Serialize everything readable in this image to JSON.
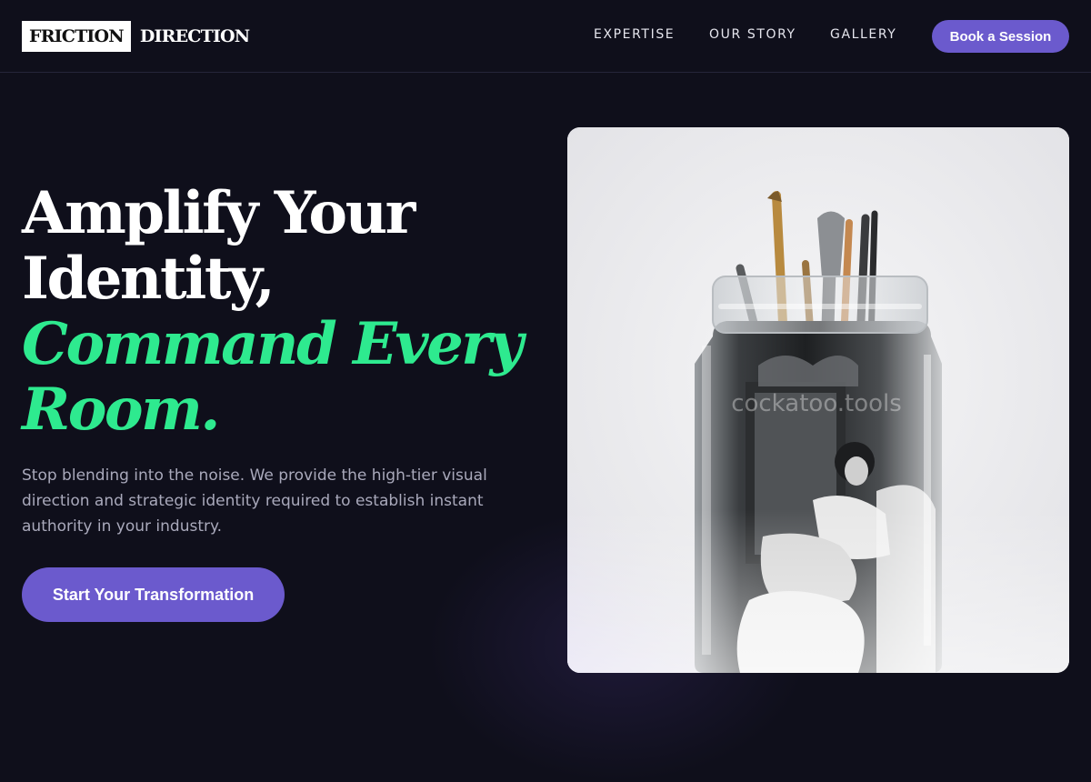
{
  "brand": {
    "logo_boxed": "FRICTION",
    "logo_text": "DIRECTION"
  },
  "nav": {
    "items": [
      {
        "label": "EXPERTISE"
      },
      {
        "label": "OUR STORY"
      },
      {
        "label": "GALLERY"
      }
    ],
    "cta_label": "Book a Session"
  },
  "hero": {
    "title_line1": "Amplify Your",
    "title_line2": "Identity,",
    "title_accent_line1": "Command Every",
    "title_accent_line2": "Room.",
    "subtitle": "Stop blending into the noise. We provide the high-tier visual direction and strategic identity required to establish instant authority in your industry.",
    "cta_label": "Start Your Transformation",
    "image": {
      "watermark": "cockatoo.tools"
    }
  },
  "colors": {
    "background": "#0f0f1b",
    "accent_green": "#2eea8f",
    "button_purple": "#6b5acd",
    "body_text": "#a9a9bb"
  }
}
